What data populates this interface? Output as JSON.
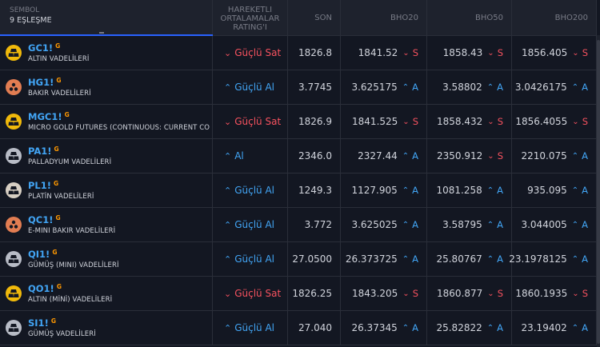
{
  "header": {
    "symbol_title": "SEMBOL",
    "match_count": "9 EŞLEŞME",
    "rating_title": "HAREKETLI ORTALAMALAR RATING'I",
    "son": "SON",
    "bho20": "BHO20",
    "bho50": "BHO50",
    "bho200": "BHO200"
  },
  "colors": {
    "sell": "#f7525f",
    "buy": "#42a5f5",
    "gold": "#f0b90b",
    "copper": "#e27d52",
    "silver": "#b8bcc6"
  },
  "rows": [
    {
      "ticker": "GC1!",
      "badge": "G",
      "desc": "ALTIN VADELİLERİ",
      "logo": "gold-bars-icon",
      "logo_color": "#f0b90b",
      "rating": "Güçlü Sat",
      "rating_dir": "sell",
      "son": "1826.8",
      "bho20": "1841.52",
      "bho20_sig": "S",
      "bho50": "1858.43",
      "bho50_sig": "S",
      "bho200": "1856.405",
      "bho200_sig": "S"
    },
    {
      "ticker": "HG1!",
      "badge": "G",
      "desc": "BAKIR VADELİLERİ",
      "logo": "copper-icon",
      "logo_color": "#e27d52",
      "rating": "Güçlü Al",
      "rating_dir": "buy",
      "son": "3.7745",
      "bho20": "3.625175",
      "bho20_sig": "A",
      "bho50": "3.58802",
      "bho50_sig": "A",
      "bho200": "3.0426175",
      "bho200_sig": "A"
    },
    {
      "ticker": "MGC1!",
      "badge": "G",
      "desc": "MICRO GOLD FUTURES (CONTINUOUS: CURRENT CO",
      "logo": "gold-bars-icon",
      "logo_color": "#f0b90b",
      "rating": "Güçlü Sat",
      "rating_dir": "sell",
      "son": "1826.9",
      "bho20": "1841.525",
      "bho20_sig": "S",
      "bho50": "1858.432",
      "bho50_sig": "S",
      "bho200": "1856.4055",
      "bho200_sig": "S"
    },
    {
      "ticker": "PA1!",
      "badge": "G",
      "desc": "PALLADYUM VADELİLERİ",
      "logo": "metal-bars-icon",
      "logo_color": "#b8bcc6",
      "rating": "Al",
      "rating_dir": "buy",
      "son": "2346.0",
      "bho20": "2327.44",
      "bho20_sig": "A",
      "bho50": "2350.912",
      "bho50_sig": "S",
      "bho200": "2210.075",
      "bho200_sig": "A"
    },
    {
      "ticker": "PL1!",
      "badge": "G",
      "desc": "PLATİN VADELİLERİ",
      "logo": "metal-bars-icon",
      "logo_color": "#d7cfc3",
      "rating": "Güçlü Al",
      "rating_dir": "buy",
      "son": "1249.3",
      "bho20": "1127.905",
      "bho20_sig": "A",
      "bho50": "1081.258",
      "bho50_sig": "A",
      "bho200": "935.095",
      "bho200_sig": "A"
    },
    {
      "ticker": "QC1!",
      "badge": "G",
      "desc": "E-MINI BAKIR VADELİLERİ",
      "logo": "copper-icon",
      "logo_color": "#e27d52",
      "rating": "Güçlü Al",
      "rating_dir": "buy",
      "son": "3.772",
      "bho20": "3.625025",
      "bho20_sig": "A",
      "bho50": "3.58795",
      "bho50_sig": "A",
      "bho200": "3.044005",
      "bho200_sig": "A"
    },
    {
      "ticker": "QI1!",
      "badge": "G",
      "desc": "GÜMÜŞ (MINI) VADELİLERİ",
      "logo": "silver-bars-icon",
      "logo_color": "#b8bcc6",
      "rating": "Güçlü Al",
      "rating_dir": "buy",
      "son": "27.0500",
      "bho20": "26.373725",
      "bho20_sig": "A",
      "bho50": "25.80767",
      "bho50_sig": "A",
      "bho200": "23.1978125",
      "bho200_sig": "A"
    },
    {
      "ticker": "QO1!",
      "badge": "G",
      "desc": "ALTIN (MİNİ) VADELİLERİ",
      "logo": "gold-bars-icon",
      "logo_color": "#f0b90b",
      "rating": "Güçlü Sat",
      "rating_dir": "sell",
      "son": "1826.25",
      "bho20": "1843.205",
      "bho20_sig": "S",
      "bho50": "1860.877",
      "bho50_sig": "S",
      "bho200": "1860.1935",
      "bho200_sig": "S"
    },
    {
      "ticker": "SI1!",
      "badge": "G",
      "desc": "GÜMÜŞ VADELİLERİ",
      "logo": "silver-bars-icon",
      "logo_color": "#b8bcc6",
      "rating": "Güçlü Al",
      "rating_dir": "buy",
      "son": "27.040",
      "bho20": "26.37345",
      "bho20_sig": "A",
      "bho50": "25.82822",
      "bho50_sig": "A",
      "bho200": "23.19402",
      "bho200_sig": "A"
    }
  ]
}
